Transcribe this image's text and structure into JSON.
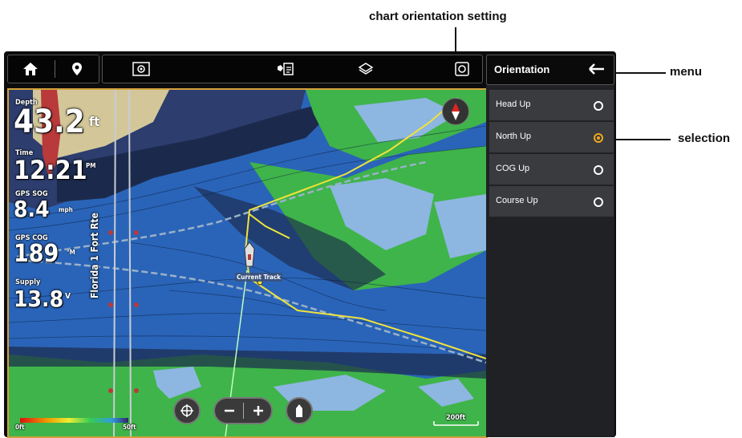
{
  "callouts": {
    "chart_orientation": "chart orientation setting",
    "menu": "menu",
    "selection": "selection"
  },
  "toolbar": {
    "icons": [
      "home-icon",
      "waypoint-pin-icon",
      "radar-settings-icon",
      "fish-id-icon",
      "layers-icon",
      "chart-settings-icon"
    ]
  },
  "panel": {
    "title": "Orientation",
    "options": [
      {
        "label": "Head Up",
        "selected": false
      },
      {
        "label": "North Up",
        "selected": true
      },
      {
        "label": "COG Up",
        "selected": false
      },
      {
        "label": "Course Up",
        "selected": false
      }
    ]
  },
  "data_bar": {
    "depth_label": "Depth",
    "depth_value": "43.2",
    "depth_unit": "ft",
    "time_label": "Time",
    "time_value": "12:21",
    "time_unit": "PM",
    "sog_label": "GPS SOG",
    "sog_value": "8.4",
    "sog_unit": "mph",
    "cog_label": "GPS COG",
    "cog_value": "189",
    "cog_unit": "°M",
    "supply_label": "Supply",
    "supply_value": "13.8",
    "supply_unit": "V"
  },
  "chart": {
    "track_label": "Current Track",
    "route_label": "Florida 1 Fort Rte",
    "scale_left": "0ft",
    "scale_right": "50ft",
    "scale_distance": "200ft",
    "colors": {
      "deep": "#2a64b8",
      "shallow": "#8db6e0",
      "land": "#3fb44a",
      "sand": "#d3c79a",
      "track": "#f1e33c",
      "frame": "#d4a13a"
    }
  }
}
